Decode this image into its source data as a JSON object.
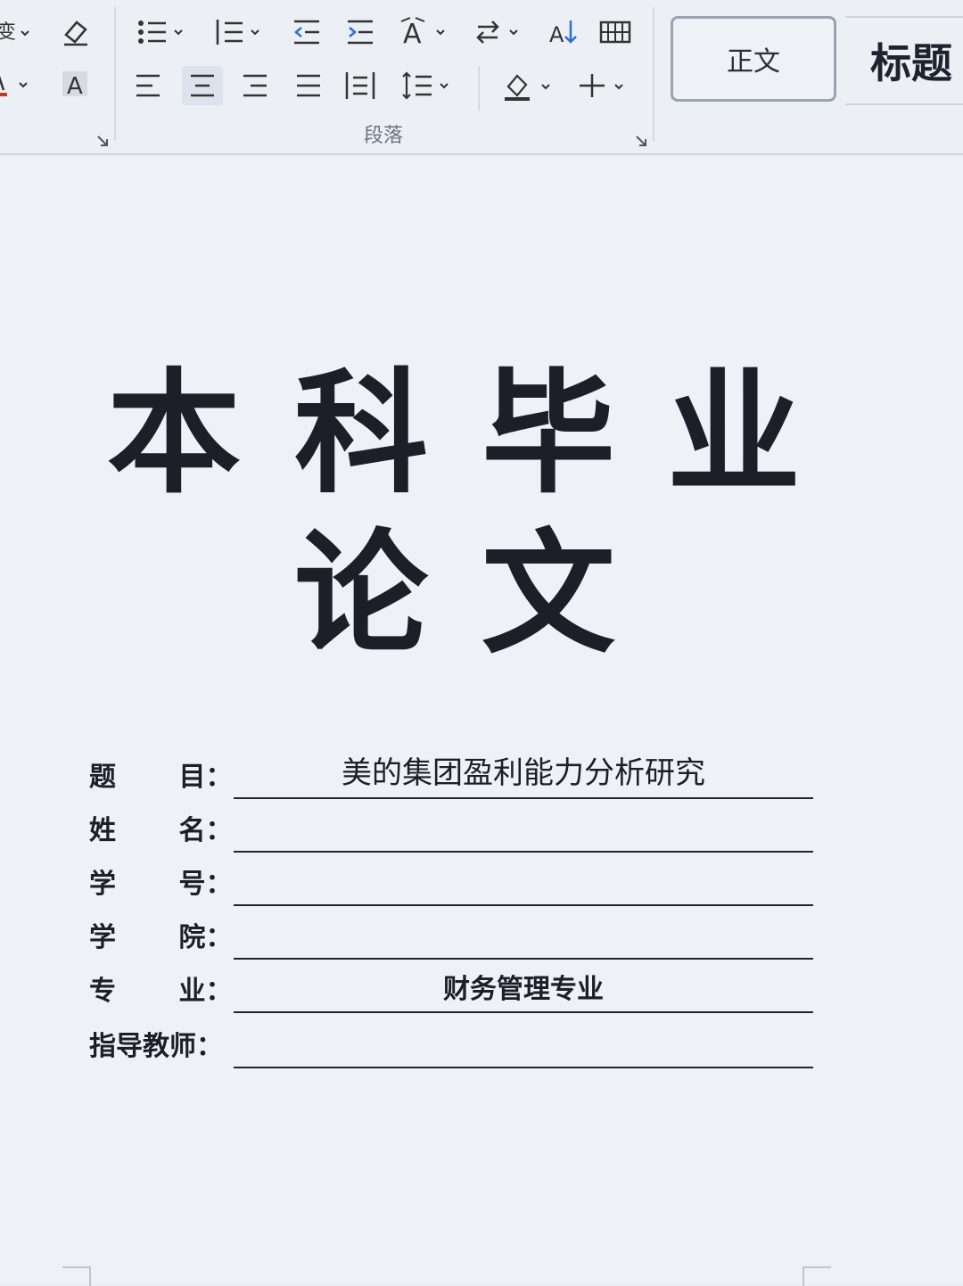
{
  "ribbon": {
    "paragraph_group_label": "段落",
    "buttons": [
      {
        "name": "bullets-icon"
      },
      {
        "name": "numbering-icon"
      },
      {
        "name": "decrease-indent-icon"
      },
      {
        "name": "increase-indent-icon"
      },
      {
        "name": "text-direction-icon"
      },
      {
        "name": "line-break-icon"
      },
      {
        "name": "sort-icon"
      },
      {
        "name": "table-icon"
      },
      {
        "name": "align-left-icon"
      },
      {
        "name": "align-center-icon"
      },
      {
        "name": "align-right-icon"
      },
      {
        "name": "justify-icon"
      },
      {
        "name": "distribute-icon"
      },
      {
        "name": "line-spacing-icon"
      },
      {
        "name": "shading-icon"
      },
      {
        "name": "borders-icon"
      },
      {
        "name": "eraser-icon"
      },
      {
        "name": "char-shading-icon"
      }
    ],
    "styles": {
      "normal": "正文",
      "heading": "标题"
    },
    "font_color_accent": "#c0392b"
  },
  "document": {
    "title_line1": [
      "本",
      "科",
      "毕",
      "业"
    ],
    "title_line2": [
      "论",
      "文"
    ],
    "form": {
      "topic": {
        "label": "题　　 目：",
        "value": "美的集团盈利能力分析研究"
      },
      "name": {
        "label": "姓　　 名：",
        "value": ""
      },
      "student_id": {
        "label": "学　　 号：",
        "value": ""
      },
      "college": {
        "label": "学　　 院：",
        "value": ""
      },
      "major": {
        "label": "专　　 业：",
        "value": "财务管理专业"
      },
      "advisor": {
        "label": "指导教师：",
        "value": ""
      }
    }
  }
}
